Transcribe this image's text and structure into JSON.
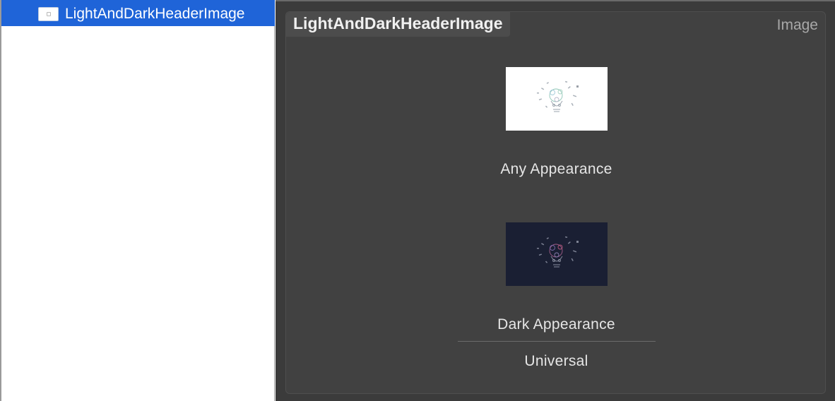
{
  "outline": {
    "items": [
      {
        "label": "LightAndDarkHeaderImage",
        "icon": "image-set-icon",
        "selected": true
      }
    ]
  },
  "editor": {
    "title": "LightAndDarkHeaderImage",
    "type_label": "Image",
    "slots": [
      {
        "caption": "Any Appearance",
        "icon": "light-header-thumbnail"
      },
      {
        "caption": "Dark Appearance",
        "icon": "dark-header-thumbnail"
      }
    ],
    "group_label": "Universal"
  },
  "colors": {
    "selection": "#1f64d8",
    "editor_bg": "#3b3b3b",
    "panel_bg": "#414141",
    "dark_thumb_bg": "#1a1f33"
  }
}
